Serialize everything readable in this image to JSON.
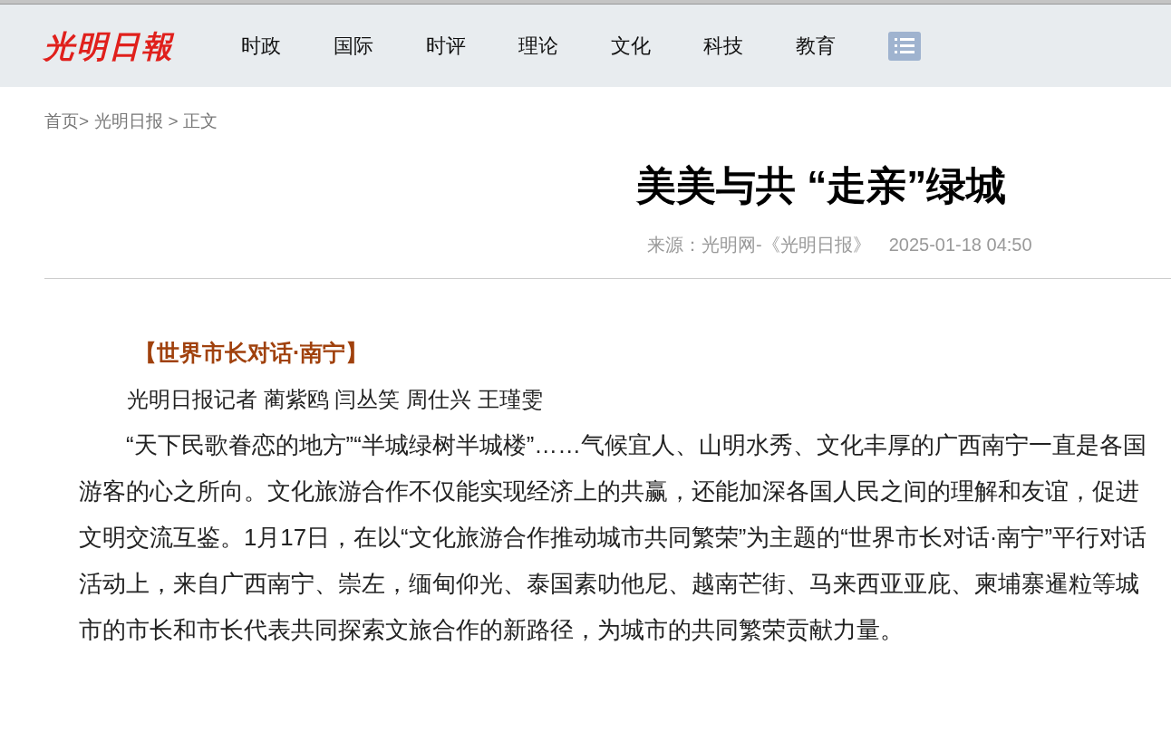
{
  "header": {
    "logo": "光明日報",
    "nav": [
      "时政",
      "国际",
      "时评",
      "理论",
      "文化",
      "科技",
      "教育"
    ]
  },
  "breadcrumb": [
    "首页>",
    "光明日报 >",
    "正文"
  ],
  "article": {
    "title": "美美与共 “走亲”绿城",
    "source": "来源：光明网-《光明日报》",
    "date": "2025-01-18 04:50",
    "kicker": "【世界市长对话·南宁】",
    "byline": "光明日报记者 蔺紫鸥 闫丛笑 周仕兴 王瑾雯",
    "paragraphs": [
      "“天下民歌眷恋的地方”“半城绿树半城楼”……气候宜人、山明水秀、文化丰厚的广西南宁一直是各国游客的心之所向。文化旅游合作不仅能实现经济上的共赢，还能加深各国人民之间的理解和友谊，促进文明交流互鉴。1月17日，在以“文化旅游合作推动城市共同繁荣”为主题的“世界市长对话·南宁”平行对话活动上，来自广西南宁、崇左，缅甸仰光、泰国素叻他尼、越南芒街、马来西亚亚庇、柬埔寨暹粒等城市的市长和市长代表共同探索文旅合作的新路径，为城市的共同繁荣贡献力量。"
    ]
  }
}
